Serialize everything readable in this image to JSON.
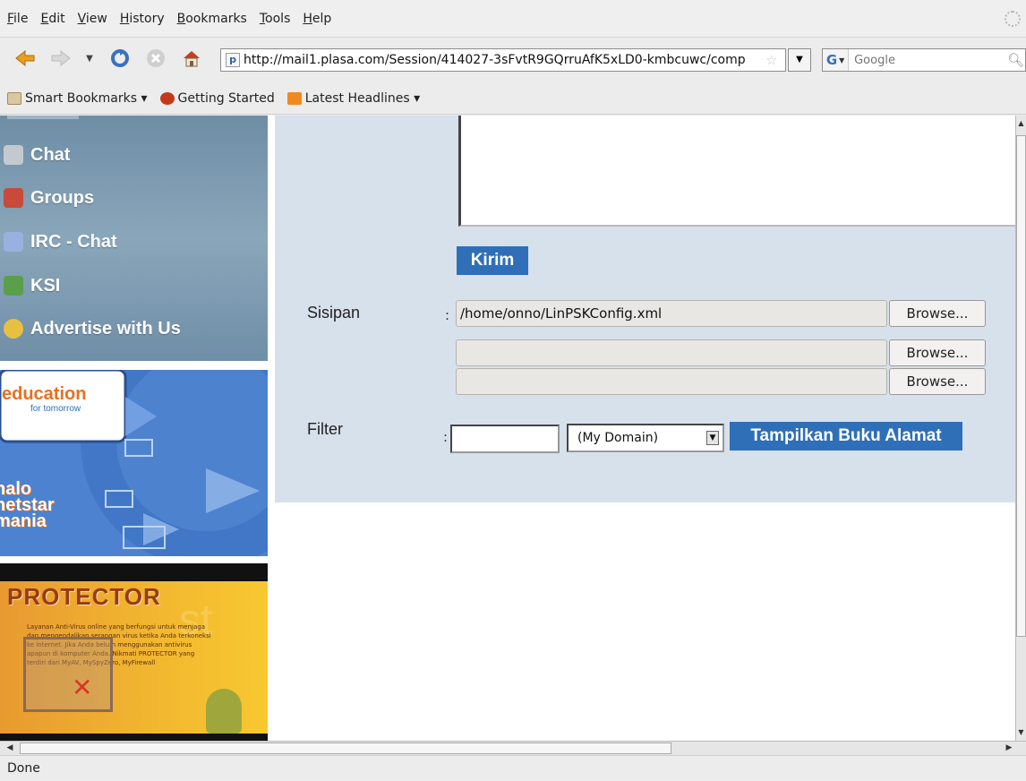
{
  "menu": [
    "File",
    "Edit",
    "View",
    "History",
    "Bookmarks",
    "Tools",
    "Help"
  ],
  "url": "http://mail1.plasa.com/Session/414027-3sFvtR9GQrruAfK5xLD0-kmbcuwc/comp",
  "search": {
    "engine": "G",
    "placeholder": "Google"
  },
  "bookmarks": [
    "Smart Bookmarks ▾",
    "Getting Started",
    "Latest Headlines ▾"
  ],
  "sidebar": {
    "items": [
      {
        "label": "Chat",
        "icon": "chat-icon",
        "color": "#c4c9cf"
      },
      {
        "label": "Groups",
        "icon": "groups-icon",
        "color": "#c84a3a"
      },
      {
        "label": "IRC - Chat",
        "icon": "irc-icon",
        "color": "#9ab0e0"
      },
      {
        "label": "KSI",
        "icon": "ksi-icon",
        "color": "#5aa04a"
      },
      {
        "label": "Advertise with Us",
        "icon": "advertise-icon",
        "color": "#e8c040"
      }
    ],
    "banner1": {
      "brand": "education",
      "sub": "for tomorrow",
      "line1": "halo",
      "line2": "netstar",
      "line3": "mania"
    },
    "banner2": {
      "brand": "PROTECTOR",
      "text": "Layanan Anti-Virus online yang berfungsi untuk menjaga dan mengendalikan serangan virus ketika Anda terkoneksi ke internet. Jika Anda belum menggunakan antivirus apapun di komputer Anda. Nikmati PROTECTOR yang terdiri dari MyAV, MySpyZero, MyFirewall"
    }
  },
  "form": {
    "send_label": "Kirim",
    "attachment_label": "Sisipan",
    "colon": ":",
    "files": [
      "/home/onno/LinPSKConfig.xml",
      "",
      ""
    ],
    "browse_label": "Browse...",
    "filter_label": "Filter",
    "filter_value": "",
    "domain_selected": "(My Domain)",
    "address_book_label": "Tampilkan Buku Alamat"
  },
  "status": "Done",
  "colors": {
    "accent": "#2f6fb7",
    "pane": "#d7e1ec",
    "sidebar": "#7d9ab0"
  }
}
